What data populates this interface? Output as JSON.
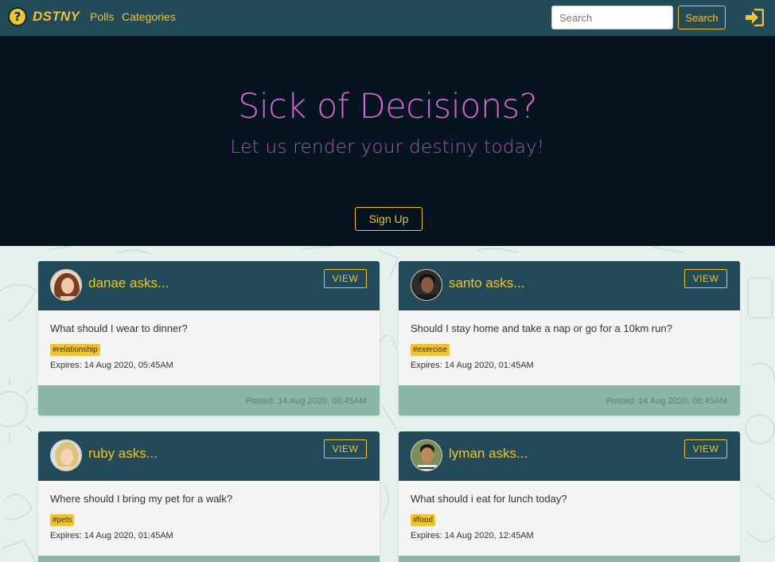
{
  "navbar": {
    "brand_icon": "?",
    "brand": "DSTNY",
    "links": [
      "Polls",
      "Categories"
    ],
    "search_placeholder": "Search",
    "search_value": "",
    "search_button": "Search",
    "login_icon": "sign-in-icon"
  },
  "hero": {
    "title": "Sick of Decisions?",
    "subtitle": "Let us render your destiny today!",
    "signup_button": "Sign Up"
  },
  "polls": [
    {
      "user": "danae asks...",
      "view": "VIEW",
      "question": "What should I wear to dinner?",
      "tag": "#relationship",
      "expires": "Expires: 14 Aug 2020, 05:45AM",
      "posted": "Posted: 14 Aug 2020, 08:45AM"
    },
    {
      "user": "santo asks...",
      "view": "VIEW",
      "question": "Should I stay home and take a nap or go for a 10km run?",
      "tag": "#exercise",
      "expires": "Expires: 14 Aug 2020, 01:45AM",
      "posted": "Posted: 14 Aug 2020, 08:45AM"
    },
    {
      "user": "ruby asks...",
      "view": "VIEW",
      "question": "Where should I bring my pet for a walk?",
      "tag": "#pets",
      "expires": "Expires: 14 Aug 2020, 01:45AM",
      "posted": ""
    },
    {
      "user": "lyman asks...",
      "view": "VIEW",
      "question": "What should i eat for lunch today?",
      "tag": "#food",
      "expires": "Expires: 14 Aug 2020, 12:45AM",
      "posted": ""
    }
  ],
  "colors": {
    "navbar": "#224a58",
    "accent": "#f1c232",
    "hero_bg": "#06141f",
    "hero_title": "#d867d6",
    "card_footer": "#8ab6aa"
  }
}
